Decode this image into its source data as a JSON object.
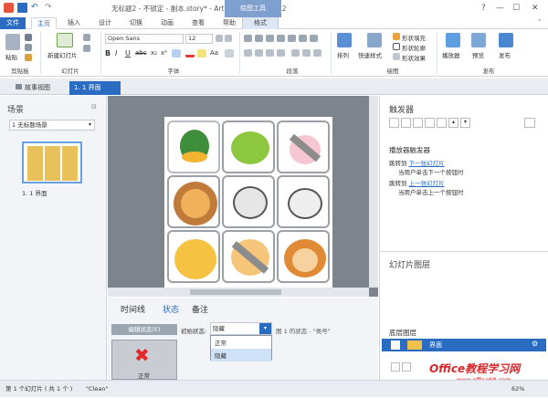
{
  "window": {
    "title": "无标题2 - 不锁定 - 副本.story* - Articulate Storyline 2",
    "context_tab": "绘图工具"
  },
  "tabs": [
    "文件",
    "主页",
    "插入",
    "设计",
    "切换",
    "动画",
    "查看",
    "帮助",
    "格式"
  ],
  "ribbon": {
    "paste": "粘贴",
    "clipboard_group": "剪贴板",
    "new_slide": "新建幻灯片",
    "slides_group": "幻灯片",
    "font_name": "Open Sans",
    "font_size": "12",
    "font_group": "字体",
    "paragraph_group": "段落",
    "arrange": "排列",
    "quick_styles": "快速样式",
    "shape_fill": "形状填充",
    "shape_outline": "形状轮廓",
    "shape_effects": "形状效果",
    "drawing_group": "绘图",
    "player": "播放器",
    "preview": "预览",
    "publish": "发布",
    "publish_group": "发布"
  },
  "doc_tabs": {
    "story_view": "故事视图",
    "current_slide": "1. 1 界面"
  },
  "scenes": {
    "header": "场景",
    "dropdown": "1 无标题场景",
    "thumb_label": "1. 1 界面"
  },
  "triggers": {
    "header": "触发器",
    "section_title": "播放器触发器",
    "t1_prefix": "跳转到",
    "t1_link": "下一张幻灯片",
    "t1_desc": "当用户单击下一个按钮时",
    "t2_prefix": "跳转到",
    "t2_link": "上一张幻灯片",
    "t2_desc": "当用户单击上一个按钮时"
  },
  "layers": {
    "header": "幻灯片图层",
    "base_label": "底层图层",
    "base_name": "界面"
  },
  "timeline": {
    "tabs": [
      "时间线",
      "状态",
      "备注"
    ],
    "edit_states": "编辑状态(E)",
    "initial_state_label": "初始状态:",
    "initial_state": "隐藏",
    "image_state": "图 1 的状态 - \"类号\"",
    "options": [
      "正常",
      "隐藏"
    ],
    "state_thumb_label": "正常"
  },
  "status": {
    "slide": "第 1 个幻灯片 ( 共 1 个 )",
    "clean": "\"Clean\"",
    "zoom": "62%"
  },
  "watermark": {
    "text": "Office教程学习网",
    "url": "www.office68.com"
  }
}
